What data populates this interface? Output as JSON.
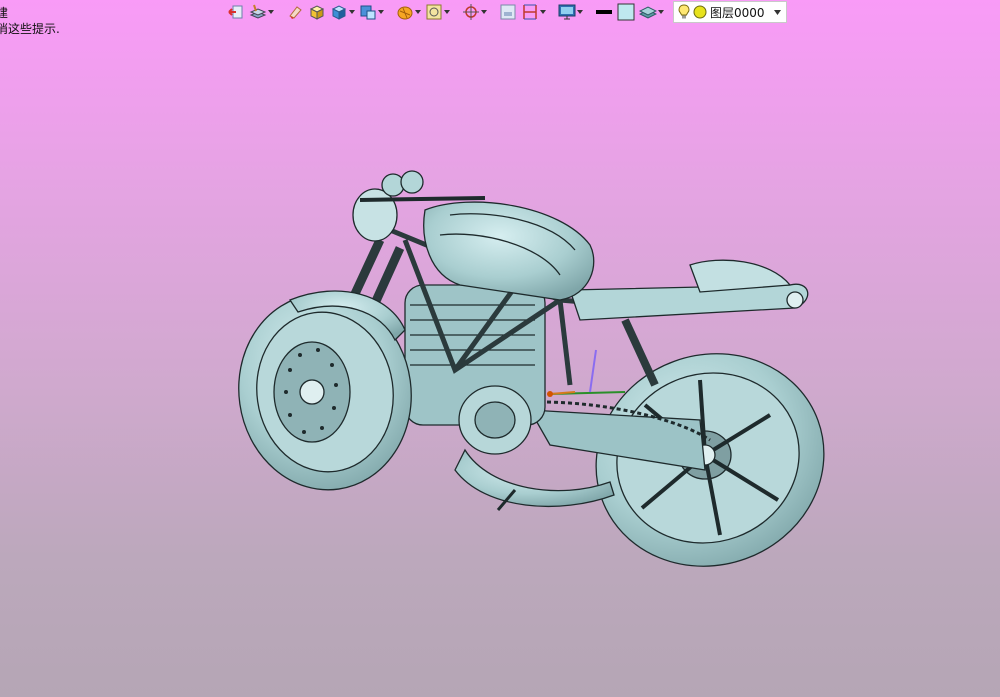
{
  "status_hints": {
    "line1": "建",
    "line2": "消这些提示."
  },
  "toolbar": {
    "buttons": [
      {
        "name": "exit-sketch-button",
        "icon": "exit-arrow-icon",
        "has_dropdown": false
      },
      {
        "name": "render-style-button",
        "icon": "layers-hand-icon",
        "has_dropdown": true
      },
      {
        "name": "eraser-button",
        "icon": "eraser-icon",
        "has_dropdown": false
      },
      {
        "name": "solid-box-button",
        "icon": "yellow-cube-icon",
        "has_dropdown": false
      },
      {
        "name": "shaded-view-button",
        "icon": "blue-cube-icon",
        "has_dropdown": true
      },
      {
        "name": "view-orientation-button",
        "icon": "view-cube-icon",
        "has_dropdown": true
      },
      {
        "name": "section-plane-button",
        "icon": "orange-disk-icon",
        "has_dropdown": true
      },
      {
        "name": "snap-button",
        "icon": "snap-square-icon",
        "has_dropdown": true
      },
      {
        "name": "locate-button",
        "icon": "crosshair-icon",
        "has_dropdown": true
      },
      {
        "name": "frame-button",
        "icon": "frame-icon",
        "has_dropdown": false
      },
      {
        "name": "dimension-button",
        "icon": "dimension-icon",
        "has_dropdown": true
      },
      {
        "name": "display-button",
        "icon": "monitor-icon",
        "has_dropdown": true
      },
      {
        "name": "line-color-button",
        "icon": "black-line-icon",
        "has_dropdown": false
      },
      {
        "name": "fill-color-button",
        "icon": "light-blue-swatch-icon",
        "has_dropdown": false
      },
      {
        "name": "layer-manager-button",
        "icon": "layer-stack-icon",
        "has_dropdown": true
      }
    ],
    "layer": {
      "label": "图层0000",
      "icons": [
        "lightbulb-icon",
        "yellow-circle-icon"
      ]
    }
  },
  "colors": {
    "background_top": "#f99bf7",
    "background_bottom": "#b5a6b5",
    "model_fill": "#a9ced0",
    "model_edge": "#1e2a2c"
  },
  "viewport": {
    "model": "motorcycle-3d-model"
  }
}
